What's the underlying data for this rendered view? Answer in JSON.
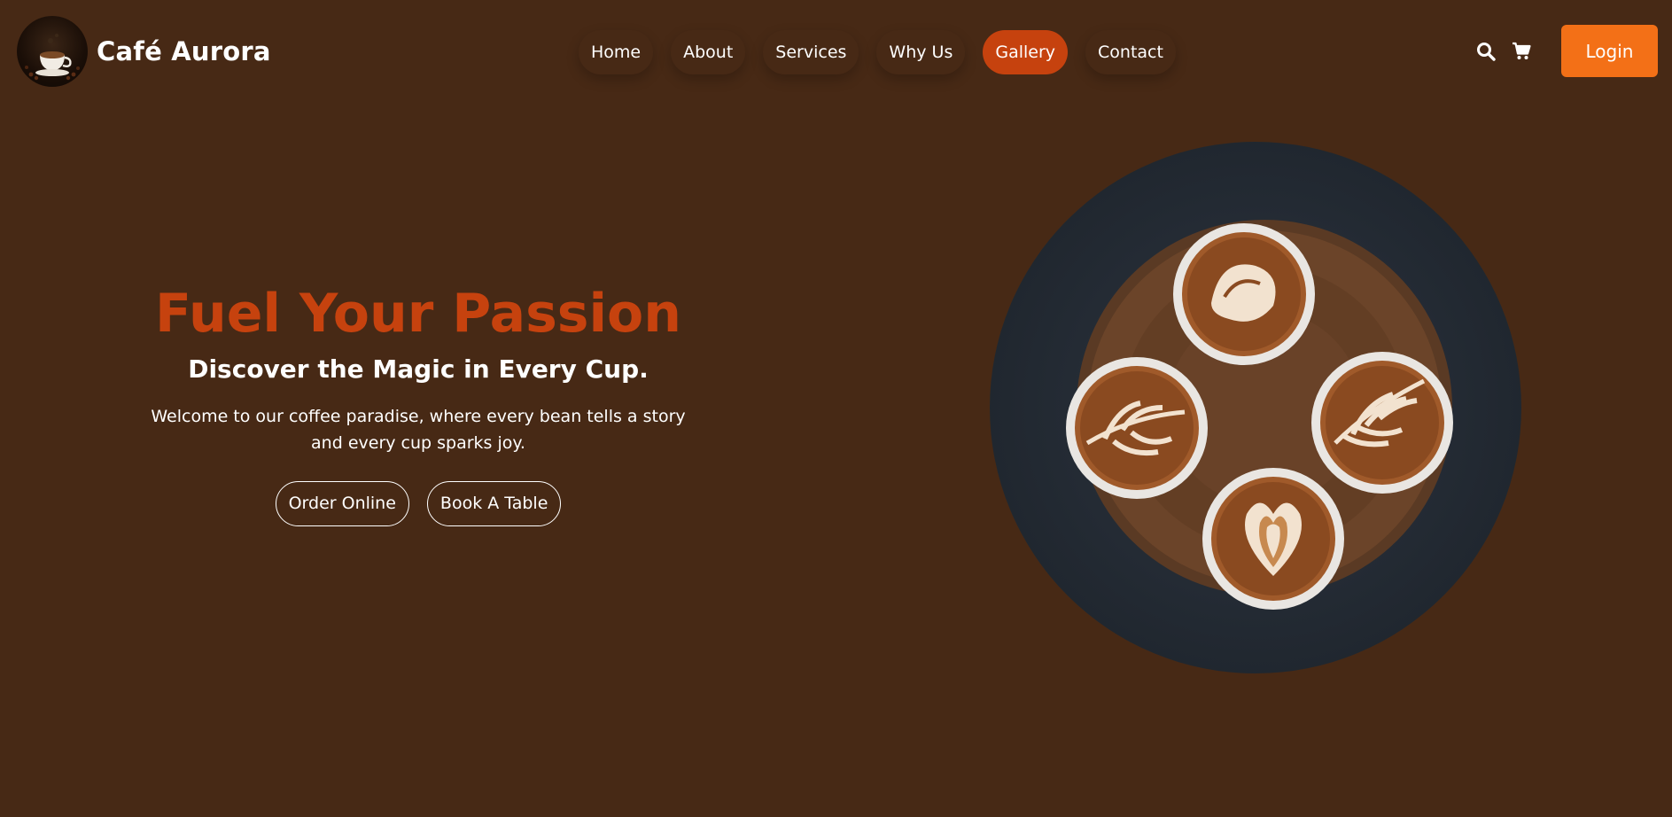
{
  "brand": {
    "name": "Café Aurora",
    "logo_icon": "coffee-cup-logo"
  },
  "nav": {
    "items": [
      {
        "label": "Home",
        "active": false
      },
      {
        "label": "About",
        "active": false
      },
      {
        "label": "Services",
        "active": false
      },
      {
        "label": "Why Us",
        "active": false
      },
      {
        "label": "Gallery",
        "active": true
      },
      {
        "label": "Contact",
        "active": false
      }
    ]
  },
  "tools": {
    "search_icon": "search-icon",
    "cart_icon": "cart-icon",
    "login_label": "Login"
  },
  "hero": {
    "title": "Fuel Your Passion",
    "subtitle": "Discover the Magic in Every Cup.",
    "description": "Welcome to our coffee paradise, where every bean tells a story and every cup sparks joy.",
    "order_label": "Order Online",
    "book_label": "Book A Table",
    "image_icon": "latte-art-image"
  },
  "colors": {
    "background": "#472915",
    "accent": "#c6420e",
    "login": "#f37017",
    "text": "#ffffff"
  }
}
